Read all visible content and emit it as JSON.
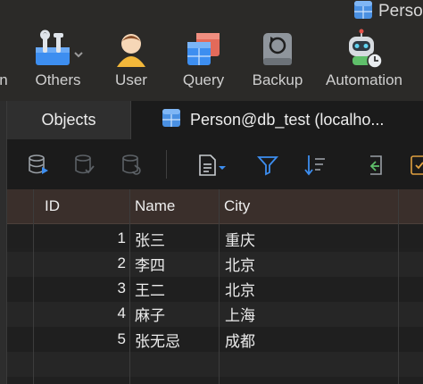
{
  "window": {
    "title": "Person"
  },
  "toolbar": {
    "items": [
      {
        "id": "partial",
        "label": "n"
      },
      {
        "id": "others",
        "label": "Others",
        "icon": "tools-icon"
      },
      {
        "id": "user",
        "label": "User",
        "icon": "user-icon"
      },
      {
        "id": "query",
        "label": "Query",
        "icon": "query-icon"
      },
      {
        "id": "backup",
        "label": "Backup",
        "icon": "backup-icon"
      },
      {
        "id": "automation",
        "label": "Automation",
        "icon": "robot-icon"
      }
    ]
  },
  "tabs": {
    "objects": "Objects",
    "table": "Person@db_test (localho..."
  },
  "grid": {
    "columns": [
      "ID",
      "Name",
      "City"
    ],
    "rows": [
      {
        "id": "1",
        "name": "张三",
        "city": "重庆"
      },
      {
        "id": "2",
        "name": "李四",
        "city": "北京"
      },
      {
        "id": "3",
        "name": "王二",
        "city": "北京"
      },
      {
        "id": "4",
        "name": "麻子",
        "city": "上海"
      },
      {
        "id": "5",
        "name": "张无忌",
        "city": "成都"
      }
    ]
  },
  "colors": {
    "toolbar_bg": "#2b2a28",
    "header_bg": "#3a2f2b",
    "accent_blue": "#3d8ef0",
    "accent_green": "#5fbf6a"
  }
}
